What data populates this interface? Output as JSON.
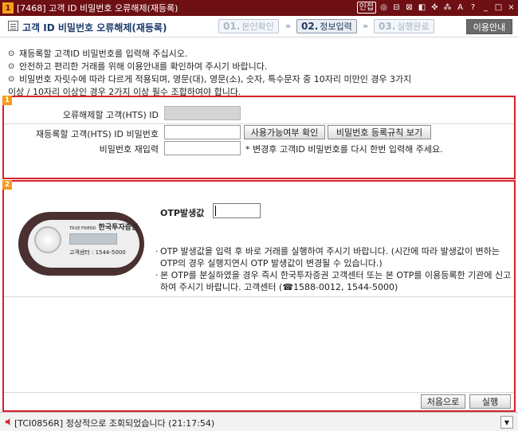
{
  "window": {
    "icon_label": "1",
    "title": "[7468] 고객 ID 비밀번호 오류해제(재등록)",
    "right_controls": [
      "인접",
      "◎",
      "⊟",
      "⊠",
      "◧",
      "✜",
      "⁂",
      "A",
      "?"
    ],
    "min_label": "_",
    "max_label": "□",
    "close_label": "×"
  },
  "header": {
    "page_title": "고객 ID 비밀번호 오류해제(재등록)",
    "steps": [
      {
        "num": "01.",
        "label": "본인확인"
      },
      {
        "num": "02.",
        "label": "정보입력"
      },
      {
        "num": "03.",
        "label": "실행완료"
      }
    ],
    "chevron": "»",
    "guide_button": "이용안내"
  },
  "notices": [
    "재등록할 고객ID 비밀번호를 입력해 주십시오.",
    "안전하고 편리한 거래를 위해 이용안내를 확인하여 주시기 바랍니다.",
    "비밀번호 자릿수에 따라 다르게 적용되며, 영문(대), 영문(소), 숫자, 특수문자 중 10자리 미만인 경우 3가지"
  ],
  "notice_continuation": "이상 / 10자리 이상인 경우 2가지 이상 필수 조합하여야 합니다.",
  "notice_bullet": "⊙",
  "section1": {
    "badge": "1",
    "id_label": "오류해제할 고객(HTS) ID",
    "pw_label": "재등록할 고객(HTS) ID 비밀번호",
    "check_button": "사용가능여부 확인",
    "rules_button": "비밀번호 등록규칙 보기",
    "confirm_label": "비밀번호 재입력",
    "confirm_note": "* 변경후 고객ID 비밀번호를 다시 한번 입력해 주세요."
  },
  "section2": {
    "badge": "2",
    "token": {
      "brand_small": "TRUE FRIEND",
      "brand": "한국투자증권",
      "phone": "고객센터 : 1544-5000"
    },
    "otp_label": "OTP발생값",
    "notes": [
      "OTP 발생값을 입력 후 바로 거래를 실행하여 주시기 바랍니다. (시간에 따라 발생값이 변하는 OTP의 경우 실행지연시 OTP 발생값이 변경될 수 있습니다.)",
      "본 OTP를 분실하였을 경우 즉시 한국투자증권 고객센터 또는 본 OTP를 이용등록한 기관에 신고하여 주시기 바랍니다. 고객센터 (☎1588-0012, 1544-5000)"
    ],
    "note_bullet": "·",
    "reset_button": "처음으로",
    "execute_button": "실행"
  },
  "status": {
    "message": "[TCI0856R] 정상적으로 조회되었습니다 (21:17:54)",
    "dropdown_glyph": "▼"
  },
  "colors": {
    "titlebar": "#6e0f14",
    "section_border": "#d6212a",
    "badge": "#f79a1e",
    "title_text": "#1c3a6b"
  }
}
